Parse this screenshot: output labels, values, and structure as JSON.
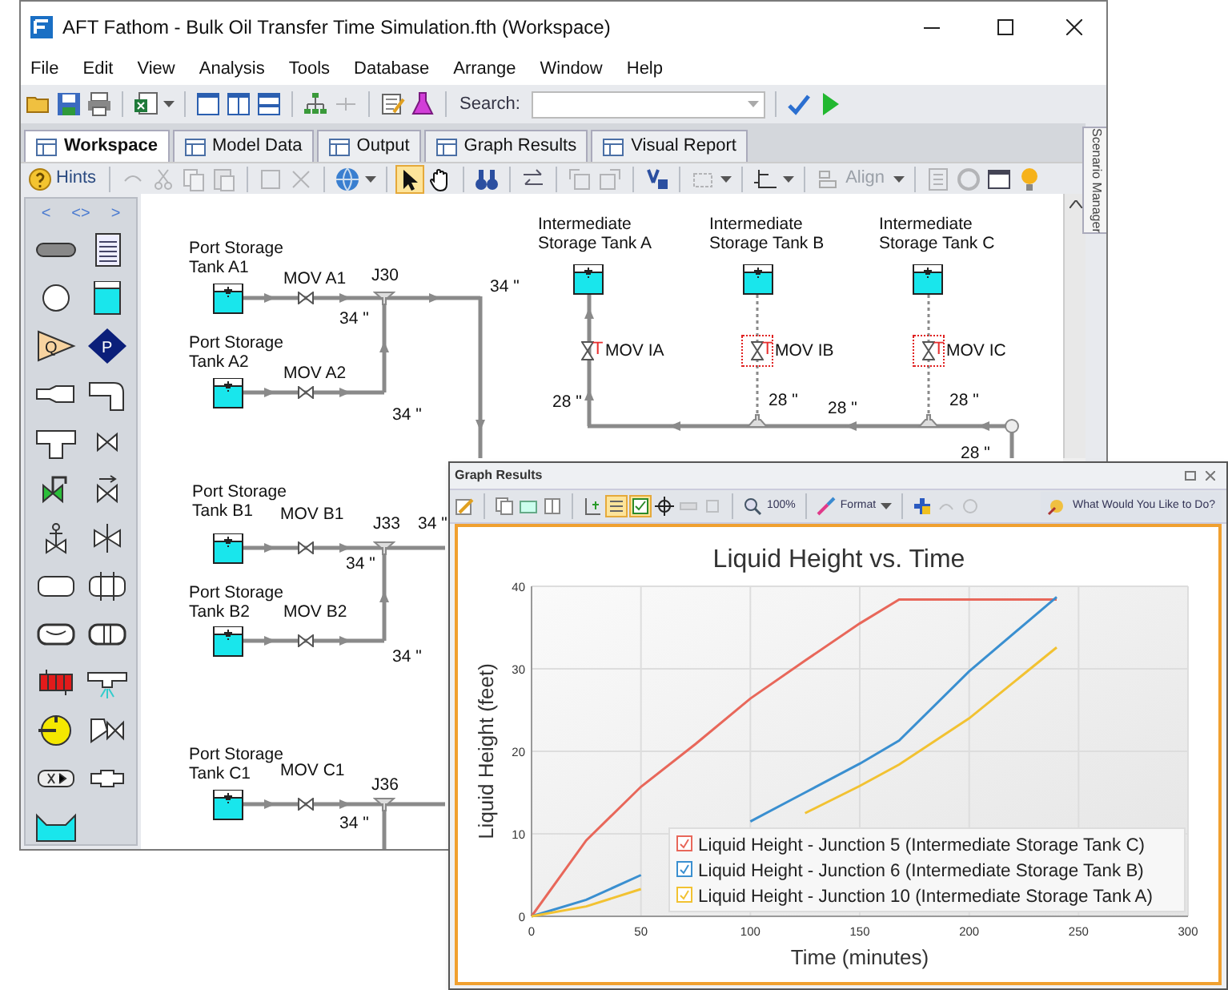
{
  "window": {
    "title": "AFT Fathom - Bulk Oil Transfer Time Simulation.fth (Workspace)"
  },
  "menu": [
    "File",
    "Edit",
    "View",
    "Analysis",
    "Tools",
    "Database",
    "Arrange",
    "Window",
    "Help"
  ],
  "toolbar": {
    "search_label": "Search:"
  },
  "tabs": [
    {
      "label": "Workspace",
      "selected": true
    },
    {
      "label": "Model Data",
      "selected": false
    },
    {
      "label": "Output",
      "selected": false
    },
    {
      "label": "Graph Results",
      "selected": false
    },
    {
      "label": "Visual Report",
      "selected": false
    }
  ],
  "workspace_toolbar": {
    "hints": "Hints",
    "align": {
      "label": "Align",
      "disabled": true
    },
    "tools": [
      {
        "selected": true
      },
      {
        "selected": false
      }
    ]
  },
  "side_panel": {
    "label": "Scenario Manager"
  },
  "palette": {
    "nav": [
      "<",
      "<>",
      ">"
    ],
    "items": [
      {
        "kind": "pipe"
      },
      {
        "kind": "annotation"
      },
      {
        "kind": "junction"
      },
      {
        "kind": "tank"
      },
      {
        "kind": "flow-source",
        "glyph": "Q"
      },
      {
        "kind": "pressure-source",
        "glyph": "P"
      },
      {
        "kind": "reducer"
      },
      {
        "kind": "bend"
      },
      {
        "kind": "tee"
      },
      {
        "kind": "valve"
      },
      {
        "kind": "control-valve"
      },
      {
        "kind": "check-valve"
      },
      {
        "kind": "relief-valve"
      },
      {
        "kind": "three-way-valve"
      },
      {
        "kind": "vessel"
      },
      {
        "kind": "separator"
      },
      {
        "kind": "capsule"
      },
      {
        "kind": "split-capsule"
      },
      {
        "kind": "heat-exchanger"
      },
      {
        "kind": "spray"
      },
      {
        "kind": "pump"
      },
      {
        "kind": "angle-valve"
      },
      {
        "kind": "filter"
      },
      {
        "kind": "connector"
      },
      {
        "kind": "reservoir"
      }
    ]
  },
  "diagram": {
    "source_tanks": [
      {
        "label": "Port Storage\nTank A1"
      },
      {
        "label": "Port Storage\nTank A2"
      },
      {
        "label": "Port Storage\nTank B1"
      },
      {
        "label": "Port Storage\nTank B2"
      },
      {
        "label": "Port Storage\nTank C1"
      }
    ],
    "source_valves": [
      {
        "label": "MOV A1"
      },
      {
        "label": "MOV A2"
      },
      {
        "label": "MOV B1"
      },
      {
        "label": "MOV B2"
      },
      {
        "label": "MOV C1"
      }
    ],
    "junctions": [
      {
        "label": "J30"
      },
      {
        "label": "J33"
      },
      {
        "label": "J36"
      }
    ],
    "pipe_sizes": [
      "34 \"",
      "34 \"",
      "34 \"",
      "34 \"",
      "34 \"",
      "34 \"",
      "34 \"",
      "28 \"",
      "28 \"",
      "28 \"",
      "28 \"",
      "28 \""
    ],
    "intermediate_tanks": [
      {
        "label": "Intermediate\nStorage Tank A"
      },
      {
        "label": "Intermediate\nStorage Tank B"
      },
      {
        "label": "Intermediate\nStorage Tank C"
      }
    ],
    "intermediate_valves": [
      {
        "label": "MOV IA",
        "flag": "T",
        "closed": false
      },
      {
        "label": "MOV IB",
        "flag": "T",
        "closed": true
      },
      {
        "label": "MOV IC",
        "flag": "T",
        "closed": true
      }
    ]
  },
  "graph_window": {
    "title": "Graph Results",
    "zoom": "100%",
    "format": "Format",
    "help": "What Would You Like to Do?",
    "toggles": [
      {
        "selected": true
      },
      {
        "selected": true
      }
    ],
    "legend": [
      {
        "checked": true
      },
      {
        "checked": true
      },
      {
        "checked": true
      }
    ],
    "chart_data": {
      "type": "line",
      "title": "Liquid Height vs. Time",
      "xlabel": "Time (minutes)",
      "ylabel": "Liquid Height (feet)",
      "x": [
        0,
        25,
        50,
        75,
        100,
        125,
        150,
        168,
        200,
        240
      ],
      "series": [
        {
          "name": "Liquid Height - Junction 5 (Intermediate Storage Tank C)",
          "color": "#e8675a",
          "values": [
            0,
            9.2,
            15.7,
            20.9,
            26.4,
            31,
            35.5,
            38.4,
            38.4,
            38.4
          ]
        },
        {
          "name": "Liquid Height - Junction 6 (Intermediate Storage Tank B)",
          "color": "#3a8fd0",
          "values": [
            0,
            2,
            5,
            null,
            11.5,
            15,
            18.5,
            21.3,
            29.7,
            38.7
          ]
        },
        {
          "name": "Liquid Height - Junction 10 (Intermediate Storage Tank A)",
          "color": "#f2c232",
          "values": [
            0,
            1.2,
            3.3,
            null,
            null,
            12.5,
            15.8,
            18.4,
            24,
            32.6
          ]
        }
      ],
      "xlim": [
        0,
        300
      ],
      "ylim": [
        0,
        40
      ],
      "xticks": [
        0,
        50,
        100,
        150,
        200,
        250,
        300
      ],
      "yticks": [
        0,
        10,
        20,
        30,
        40
      ],
      "grid": true,
      "legend": true
    }
  }
}
